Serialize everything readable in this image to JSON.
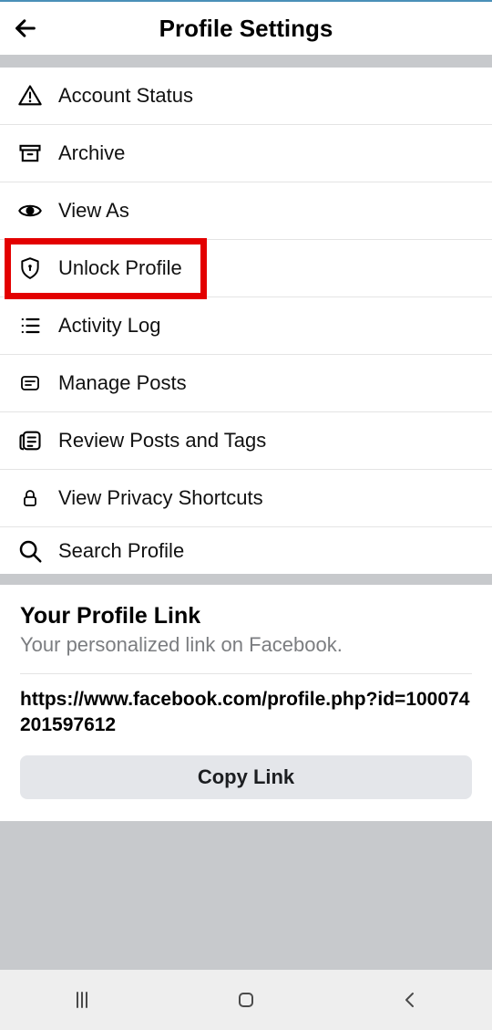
{
  "header": {
    "title": "Profile Settings"
  },
  "menu": [
    {
      "key": "account-status",
      "label": "Account Status",
      "icon": "warning"
    },
    {
      "key": "archive",
      "label": "Archive",
      "icon": "archive"
    },
    {
      "key": "view-as",
      "label": "View As",
      "icon": "eye"
    },
    {
      "key": "unlock-profile",
      "label": "Unlock Profile",
      "icon": "shield"
    },
    {
      "key": "activity-log",
      "label": "Activity Log",
      "icon": "list"
    },
    {
      "key": "manage-posts",
      "label": "Manage Posts",
      "icon": "post"
    },
    {
      "key": "review-posts-tags",
      "label": "Review Posts and Tags",
      "icon": "review"
    },
    {
      "key": "view-privacy-shortcuts",
      "label": "View Privacy Shortcuts",
      "icon": "lock"
    },
    {
      "key": "search-profile",
      "label": "Search Profile",
      "icon": "search"
    }
  ],
  "highlight_index": 3,
  "link_section": {
    "title": "Your Profile Link",
    "subtitle": "Your personalized link on Facebook.",
    "url": "https://www.facebook.com/profile.php?id=100074201597612",
    "copy_label": "Copy Link"
  }
}
